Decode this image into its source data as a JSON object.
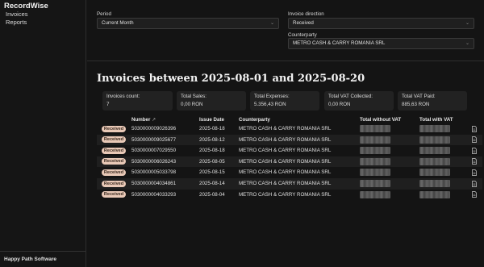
{
  "sidebar": {
    "brand": "RecordWise",
    "items": [
      {
        "label": "Invoices"
      },
      {
        "label": "Reports"
      }
    ],
    "footer": "Happy Path Software"
  },
  "filters": {
    "period_label": "Period",
    "period_value": "Current Month",
    "direction_label": "Invoice direction",
    "direction_value": "Received",
    "counterparty_label": "Counterparty",
    "counterparty_value": "METRO CASH & CARRY ROMANIA SRL"
  },
  "heading": "Invoices between 2025-08-01 and 2025-08-20",
  "cards": [
    {
      "label": "Invoices count:",
      "value": "7"
    },
    {
      "label": "Total Sales:",
      "value": "0,00 RON"
    },
    {
      "label": "Total Expenses:",
      "value": "5.356,43 RON"
    },
    {
      "label": "Total VAT Collected:",
      "value": "0,00 RON"
    },
    {
      "label": "Total VAT Paid:",
      "value": "885,63 RON"
    }
  ],
  "table": {
    "headers": {
      "number": "Number",
      "issue_date": "Issue Date",
      "counterparty": "Counterparty",
      "total_without_vat": "Total without VAT",
      "total_with_vat": "Total with VAT"
    },
    "rows": [
      {
        "status": "Received",
        "number": "5030000009026396",
        "date": "2025-08-18",
        "counterparty": "METRO CASH & CARRY ROMANIA SRL"
      },
      {
        "status": "Received",
        "number": "5030000009025677",
        "date": "2025-08-12",
        "counterparty": "METRO CASH & CARRY ROMANIA SRL"
      },
      {
        "status": "Received",
        "number": "5030000007029550",
        "date": "2025-08-18",
        "counterparty": "METRO CASH & CARRY ROMANIA SRL"
      },
      {
        "status": "Received",
        "number": "5030000006026243",
        "date": "2025-08-05",
        "counterparty": "METRO CASH & CARRY ROMANIA SRL"
      },
      {
        "status": "Received",
        "number": "5030000005033798",
        "date": "2025-08-15",
        "counterparty": "METRO CASH & CARRY ROMANIA SRL"
      },
      {
        "status": "Received",
        "number": "5030000004034861",
        "date": "2025-08-14",
        "counterparty": "METRO CASH & CARRY ROMANIA SRL"
      },
      {
        "status": "Received",
        "number": "5030000004033293",
        "date": "2025-08-04",
        "counterparty": "METRO CASH & CARRY ROMANIA SRL"
      }
    ]
  },
  "icons": {
    "select_chevron": "chevron-down-icon",
    "sort": "external-link-icon",
    "row_action": "pdf-document-icon"
  },
  "colors": {
    "background": "#141414",
    "card": "#222222",
    "badge": "#e9c9b7",
    "row_alt": "#1f1f1f"
  }
}
